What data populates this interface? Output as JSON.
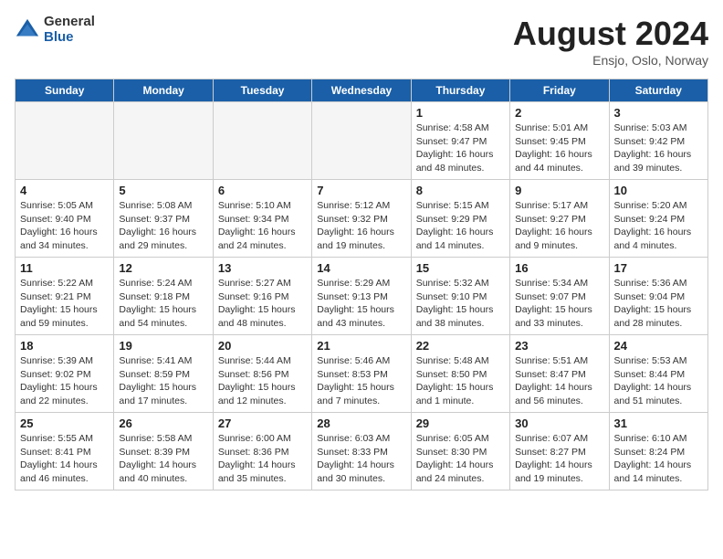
{
  "header": {
    "logo_general": "General",
    "logo_blue": "Blue",
    "month_title": "August 2024",
    "subtitle": "Ensjo, Oslo, Norway"
  },
  "days_of_week": [
    "Sunday",
    "Monday",
    "Tuesday",
    "Wednesday",
    "Thursday",
    "Friday",
    "Saturday"
  ],
  "weeks": [
    [
      {
        "day": "",
        "info": ""
      },
      {
        "day": "",
        "info": ""
      },
      {
        "day": "",
        "info": ""
      },
      {
        "day": "",
        "info": ""
      },
      {
        "day": "1",
        "info": "Sunrise: 4:58 AM\nSunset: 9:47 PM\nDaylight: 16 hours\nand 48 minutes."
      },
      {
        "day": "2",
        "info": "Sunrise: 5:01 AM\nSunset: 9:45 PM\nDaylight: 16 hours\nand 44 minutes."
      },
      {
        "day": "3",
        "info": "Sunrise: 5:03 AM\nSunset: 9:42 PM\nDaylight: 16 hours\nand 39 minutes."
      }
    ],
    [
      {
        "day": "4",
        "info": "Sunrise: 5:05 AM\nSunset: 9:40 PM\nDaylight: 16 hours\nand 34 minutes."
      },
      {
        "day": "5",
        "info": "Sunrise: 5:08 AM\nSunset: 9:37 PM\nDaylight: 16 hours\nand 29 minutes."
      },
      {
        "day": "6",
        "info": "Sunrise: 5:10 AM\nSunset: 9:34 PM\nDaylight: 16 hours\nand 24 minutes."
      },
      {
        "day": "7",
        "info": "Sunrise: 5:12 AM\nSunset: 9:32 PM\nDaylight: 16 hours\nand 19 minutes."
      },
      {
        "day": "8",
        "info": "Sunrise: 5:15 AM\nSunset: 9:29 PM\nDaylight: 16 hours\nand 14 minutes."
      },
      {
        "day": "9",
        "info": "Sunrise: 5:17 AM\nSunset: 9:27 PM\nDaylight: 16 hours\nand 9 minutes."
      },
      {
        "day": "10",
        "info": "Sunrise: 5:20 AM\nSunset: 9:24 PM\nDaylight: 16 hours\nand 4 minutes."
      }
    ],
    [
      {
        "day": "11",
        "info": "Sunrise: 5:22 AM\nSunset: 9:21 PM\nDaylight: 15 hours\nand 59 minutes."
      },
      {
        "day": "12",
        "info": "Sunrise: 5:24 AM\nSunset: 9:18 PM\nDaylight: 15 hours\nand 54 minutes."
      },
      {
        "day": "13",
        "info": "Sunrise: 5:27 AM\nSunset: 9:16 PM\nDaylight: 15 hours\nand 48 minutes."
      },
      {
        "day": "14",
        "info": "Sunrise: 5:29 AM\nSunset: 9:13 PM\nDaylight: 15 hours\nand 43 minutes."
      },
      {
        "day": "15",
        "info": "Sunrise: 5:32 AM\nSunset: 9:10 PM\nDaylight: 15 hours\nand 38 minutes."
      },
      {
        "day": "16",
        "info": "Sunrise: 5:34 AM\nSunset: 9:07 PM\nDaylight: 15 hours\nand 33 minutes."
      },
      {
        "day": "17",
        "info": "Sunrise: 5:36 AM\nSunset: 9:04 PM\nDaylight: 15 hours\nand 28 minutes."
      }
    ],
    [
      {
        "day": "18",
        "info": "Sunrise: 5:39 AM\nSunset: 9:02 PM\nDaylight: 15 hours\nand 22 minutes."
      },
      {
        "day": "19",
        "info": "Sunrise: 5:41 AM\nSunset: 8:59 PM\nDaylight: 15 hours\nand 17 minutes."
      },
      {
        "day": "20",
        "info": "Sunrise: 5:44 AM\nSunset: 8:56 PM\nDaylight: 15 hours\nand 12 minutes."
      },
      {
        "day": "21",
        "info": "Sunrise: 5:46 AM\nSunset: 8:53 PM\nDaylight: 15 hours\nand 7 minutes."
      },
      {
        "day": "22",
        "info": "Sunrise: 5:48 AM\nSunset: 8:50 PM\nDaylight: 15 hours\nand 1 minute."
      },
      {
        "day": "23",
        "info": "Sunrise: 5:51 AM\nSunset: 8:47 PM\nDaylight: 14 hours\nand 56 minutes."
      },
      {
        "day": "24",
        "info": "Sunrise: 5:53 AM\nSunset: 8:44 PM\nDaylight: 14 hours\nand 51 minutes."
      }
    ],
    [
      {
        "day": "25",
        "info": "Sunrise: 5:55 AM\nSunset: 8:41 PM\nDaylight: 14 hours\nand 46 minutes."
      },
      {
        "day": "26",
        "info": "Sunrise: 5:58 AM\nSunset: 8:39 PM\nDaylight: 14 hours\nand 40 minutes."
      },
      {
        "day": "27",
        "info": "Sunrise: 6:00 AM\nSunset: 8:36 PM\nDaylight: 14 hours\nand 35 minutes."
      },
      {
        "day": "28",
        "info": "Sunrise: 6:03 AM\nSunset: 8:33 PM\nDaylight: 14 hours\nand 30 minutes."
      },
      {
        "day": "29",
        "info": "Sunrise: 6:05 AM\nSunset: 8:30 PM\nDaylight: 14 hours\nand 24 minutes."
      },
      {
        "day": "30",
        "info": "Sunrise: 6:07 AM\nSunset: 8:27 PM\nDaylight: 14 hours\nand 19 minutes."
      },
      {
        "day": "31",
        "info": "Sunrise: 6:10 AM\nSunset: 8:24 PM\nDaylight: 14 hours\nand 14 minutes."
      }
    ]
  ]
}
